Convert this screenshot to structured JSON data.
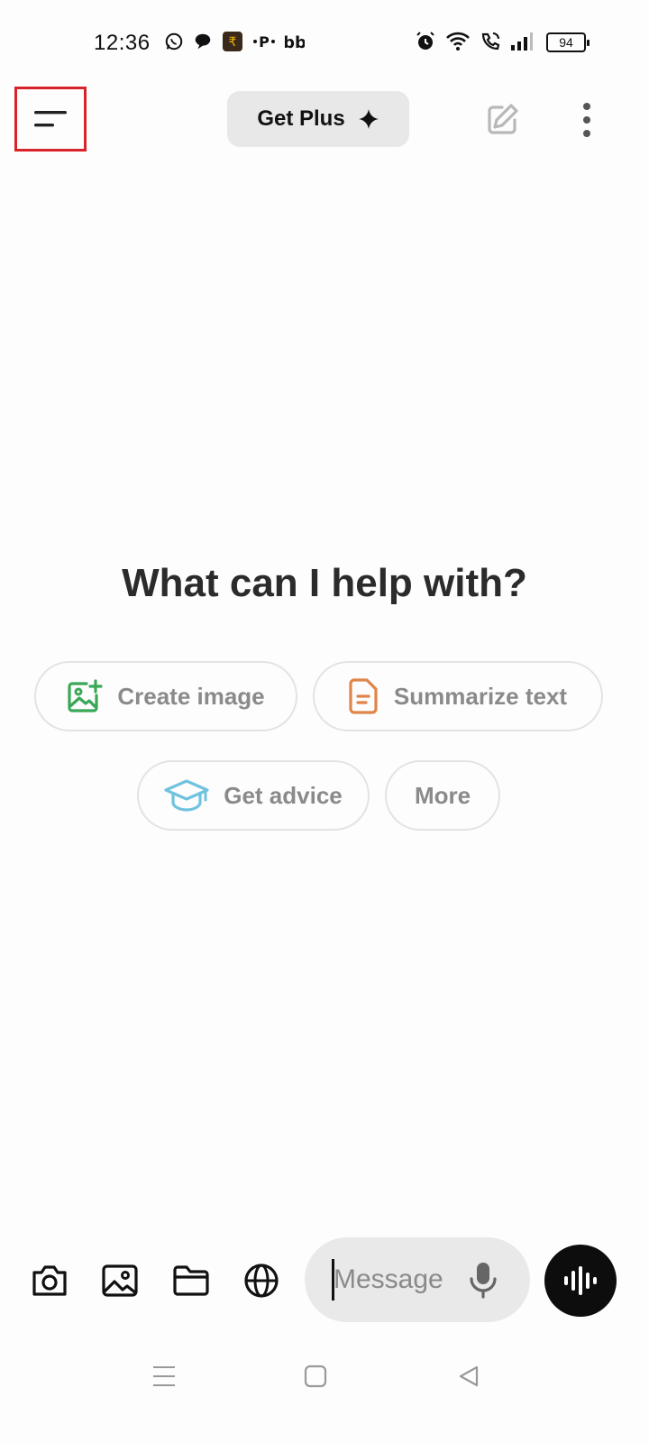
{
  "status_bar": {
    "time": "12:36",
    "battery": "94"
  },
  "app_bar": {
    "menu_icon": "hamburger-menu-icon",
    "get_plus_label": "Get Plus",
    "get_plus_icon": "sparkle-icon",
    "new_chat_icon": "edit-pencil-icon",
    "more_icon": "vertical-dots-icon"
  },
  "main": {
    "headline": "What can I help with?",
    "suggestions": [
      {
        "label": "Create image",
        "icon": "image-add-icon",
        "icon_color": "#3aa757"
      },
      {
        "label": "Summarize text",
        "icon": "document-icon",
        "icon_color": "#e0854a"
      },
      {
        "label": "Get advice",
        "icon": "graduation-cap-icon",
        "icon_color": "#6fc3de"
      },
      {
        "label": "More",
        "icon": ""
      }
    ]
  },
  "composer": {
    "placeholder": "Message",
    "tools": [
      "camera-icon",
      "photo-icon",
      "folder-icon",
      "globe-icon"
    ],
    "mic_icon": "microphone-icon",
    "voice_icon": "voice-waveform-icon"
  },
  "colors": {
    "highlight_border": "#d8232a",
    "voice_button_bg": "#0d0d0d"
  }
}
